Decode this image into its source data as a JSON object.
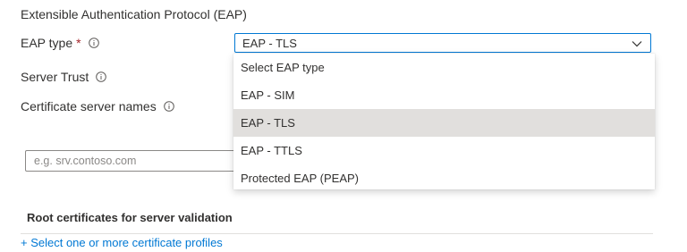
{
  "section": {
    "title": "Extensible Authentication Protocol (EAP)"
  },
  "fields": {
    "eap_type": {
      "label": "EAP type",
      "required_mark": "*",
      "selected_value": "EAP - TLS"
    },
    "server_trust": {
      "label": "Server Trust"
    },
    "certificate_server_names": {
      "label": "Certificate server names",
      "placeholder": "e.g. srv.contoso.com"
    }
  },
  "dropdown": {
    "options": [
      {
        "label": "Select EAP type",
        "selected": false
      },
      {
        "label": "EAP - SIM",
        "selected": false
      },
      {
        "label": "EAP - TLS",
        "selected": true
      },
      {
        "label": "EAP - TTLS",
        "selected": false
      },
      {
        "label": "Protected EAP (PEAP)",
        "selected": false
      }
    ]
  },
  "root_certificates": {
    "heading": "Root certificates for server validation",
    "link_label": "+ Select one or more certificate profiles"
  },
  "colors": {
    "accent": "#0078d4",
    "required": "#a4262c",
    "selected_option": "#e1dfdd",
    "text": "#323130"
  },
  "icons": {
    "info": "info-icon",
    "chevron": "chevron-down-icon"
  }
}
